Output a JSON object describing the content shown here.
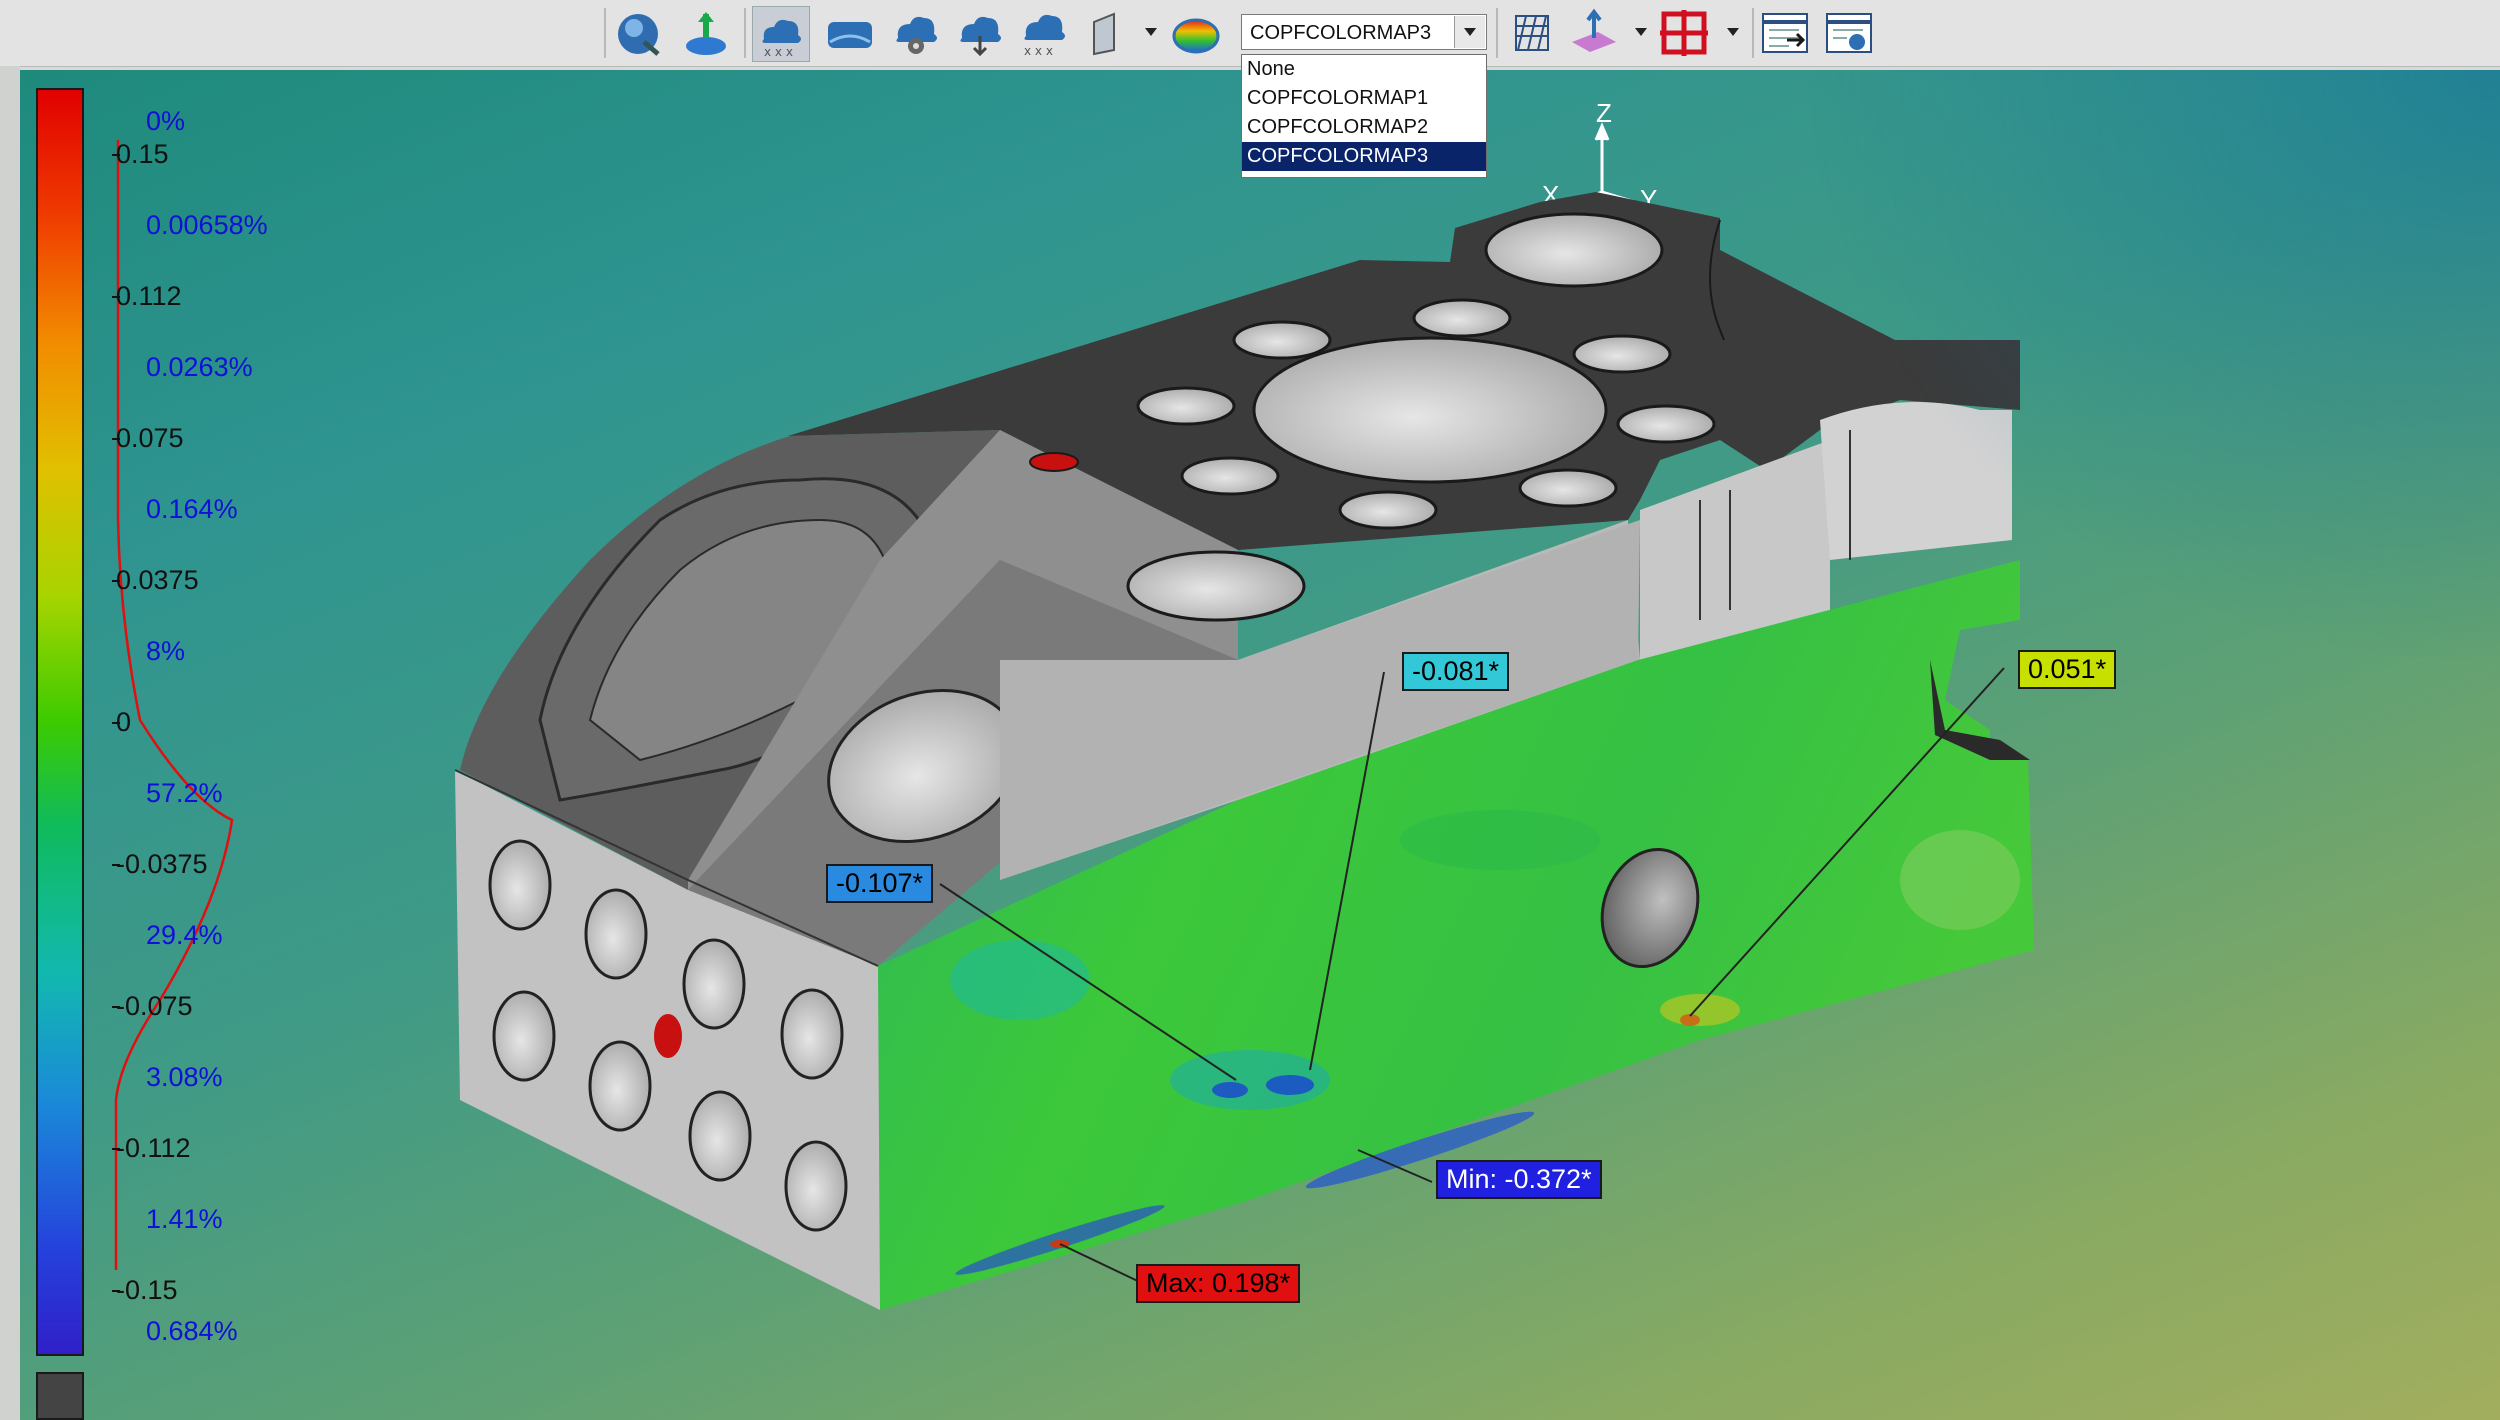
{
  "toolbar": {
    "icons": [
      "scan-icon",
      "probe-point-icon",
      "cloud-grid-icon",
      "cloud-surface-icon",
      "cloud-settings-icon",
      "cloud-download-icon",
      "cloud-delete-icon",
      "section-view-icon",
      "colormap-icon",
      "grid-mesh-icon",
      "measure-plane-icon",
      "crosshair-icon",
      "report-export-icon",
      "report-settings-icon"
    ],
    "colormap_select": {
      "value": "COPFCOLORMAP3",
      "options": [
        "None",
        "COPFCOLORMAP1",
        "COPFCOLORMAP2",
        "COPFCOLORMAP3"
      ],
      "selected_index": 3
    }
  },
  "legend": {
    "values": [
      "0.15",
      "0.112",
      "0.075",
      "0.0375",
      "0",
      "-0.0375",
      "-0.075",
      "-0.112",
      "-0.15"
    ],
    "percentages": [
      "0%",
      "0.00658%",
      "0.0263%",
      "0.164%",
      "8%",
      "57.2%",
      "29.4%",
      "3.08%",
      "1.41%",
      "0.684%"
    ]
  },
  "axes": {
    "z": "Z",
    "x": "X",
    "y": "Y"
  },
  "callouts": {
    "c1": {
      "text": "-0.081*",
      "color": "#32c8d8"
    },
    "c2": {
      "text": "0.051*",
      "color": "#c8e000"
    },
    "c3": {
      "text": "-0.107*",
      "color": "#2a8ae0"
    },
    "min": {
      "text": "Min: -0.372*",
      "color": "#2020e0"
    },
    "max": {
      "text": "Max: 0.198*",
      "color": "#e01010"
    }
  }
}
